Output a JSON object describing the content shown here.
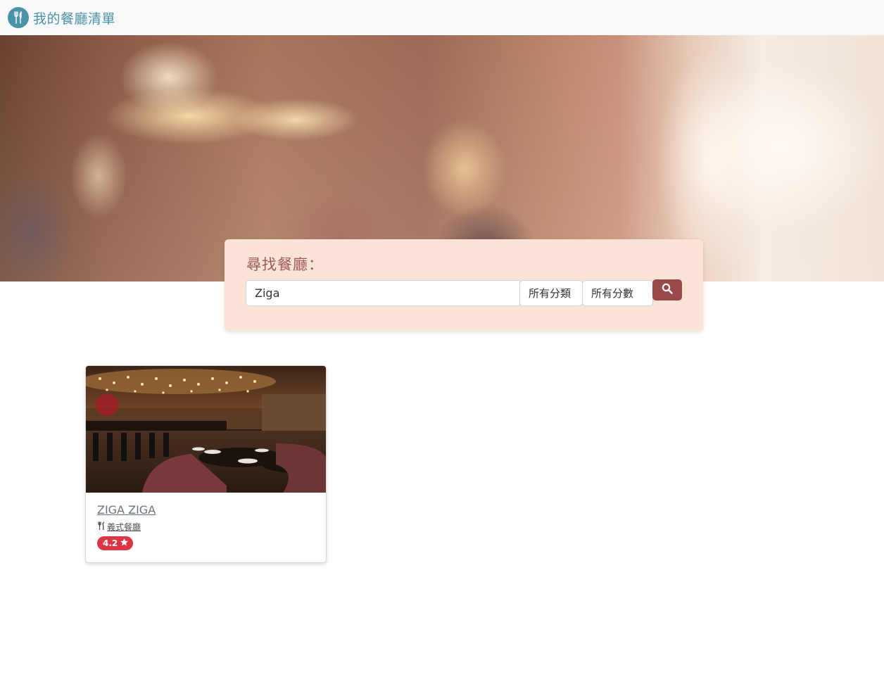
{
  "navbar": {
    "brand_title": "我的餐廳清單",
    "brand_icon": "utensils-icon",
    "brand_color": "#4a93a8"
  },
  "search": {
    "title": "尋找餐廳：",
    "query": "Ziga",
    "category_label": "所有分類",
    "rating_label": "所有分數",
    "button_icon": "search-icon",
    "panel_color": "#fbe3d7",
    "button_color": "#9b4a4c"
  },
  "restaurants": [
    {
      "name": "ZIGA ZIGA",
      "category": "義式餐廳",
      "category_icon": "utensils-icon",
      "rating": "4.2",
      "rating_icon": "star-icon",
      "badge_color": "#dc3545"
    }
  ]
}
